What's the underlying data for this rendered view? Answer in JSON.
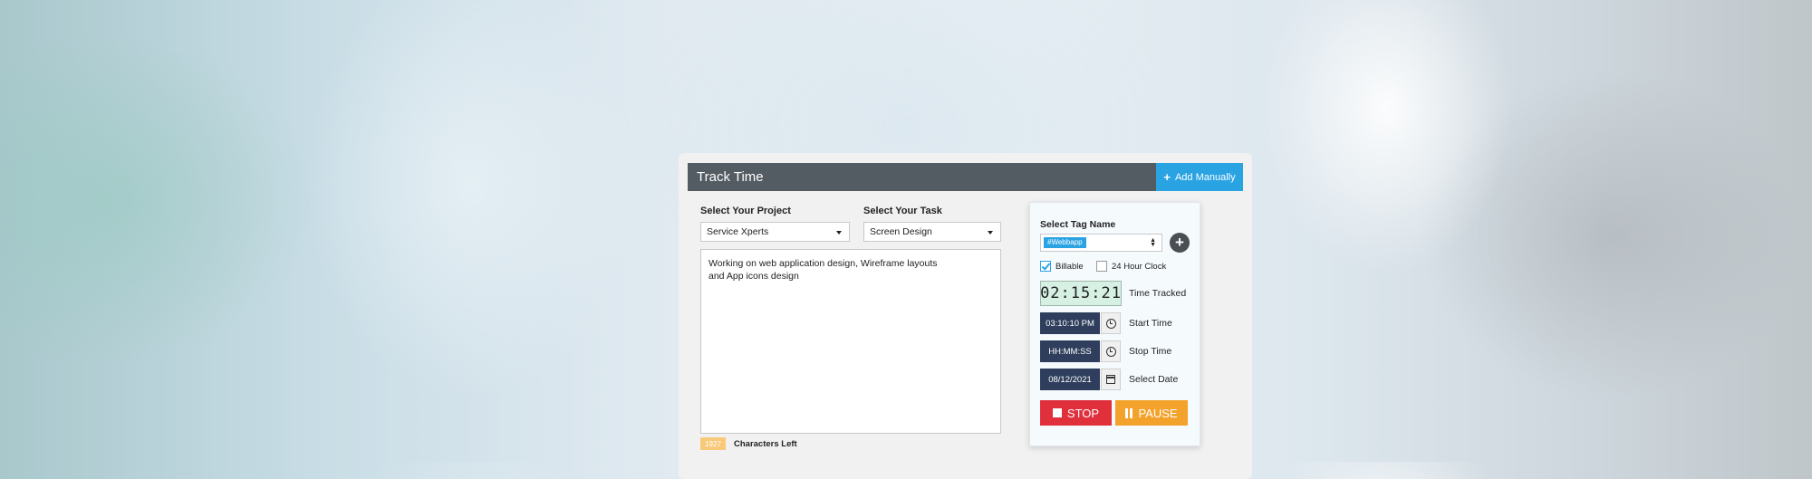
{
  "header": {
    "title": "Track Time",
    "add_manually": "Add Manually"
  },
  "form": {
    "project_label": "Select Your Project",
    "project_value": "Service Xperts",
    "task_label": "Select Your Task",
    "task_value": "Screen Design",
    "description": "Working on web application design, Wireframe layouts\nand App icons design",
    "chars_left_count": "1927",
    "chars_left_label": "Characters Left"
  },
  "panel": {
    "tag_label": "Select Tag Name",
    "tag_value": "#Webbapp",
    "billable_label": "Billable",
    "billable_checked": true,
    "clock24_label": "24 Hour Clock",
    "clock24_checked": false,
    "timer_value": "02:15:21",
    "timer_label": "Time Tracked",
    "start_value": "03:10:10 PM",
    "start_label": "Start Time",
    "stop_value": "HH:MM:SS",
    "stop_label": "Stop Time",
    "date_value": "08/12/2021",
    "date_label": "Select Date",
    "stop_button": "STOP",
    "pause_button": "PAUSE"
  },
  "colors": {
    "header_bg": "#545c63",
    "accent": "#2aa3e3",
    "stop": "#e0303c",
    "pause": "#f3a22b",
    "time_field": "#2e3e5c"
  },
  "icons": [
    "plus-icon",
    "caret-down-icon",
    "add-circle-icon",
    "check-icon",
    "clock-icon",
    "calendar-icon",
    "stop-icon",
    "pause-icon"
  ]
}
